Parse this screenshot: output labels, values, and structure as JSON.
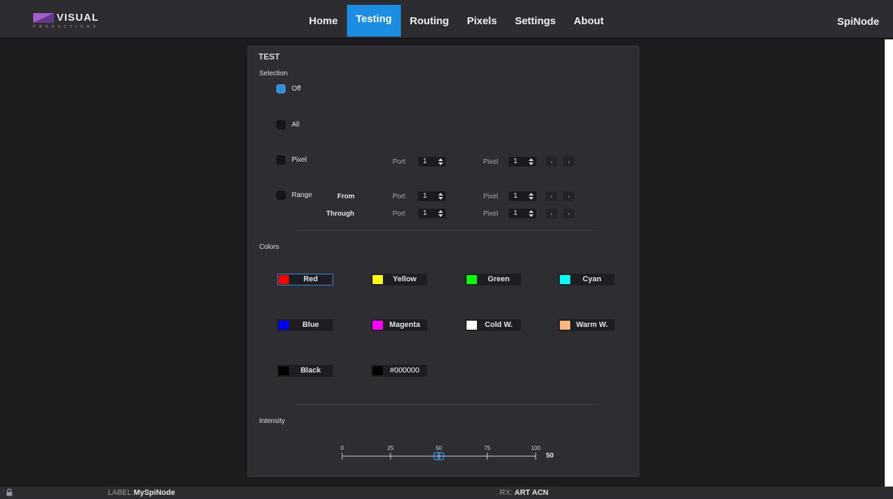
{
  "brand": {
    "name": "VISUAL",
    "tagline": "PRODUCTIONS",
    "colors": {
      "mark_light": "#a35fc9",
      "mark_dark": "#6a3592"
    }
  },
  "nav": {
    "items": [
      {
        "label": "Home"
      },
      {
        "label": "Testing"
      },
      {
        "label": "Routing"
      },
      {
        "label": "Pixels"
      },
      {
        "label": "Settings"
      },
      {
        "label": "About"
      }
    ],
    "active": "Testing"
  },
  "device_name": "SpiNode",
  "test": {
    "title": "TEST",
    "selection": {
      "label": "Selection",
      "options": [
        {
          "label": "Off",
          "checked": true
        },
        {
          "label": "All",
          "checked": false
        },
        {
          "label": "Pixel",
          "checked": false
        },
        {
          "label": "Range",
          "checked": false
        }
      ],
      "pixel_row": {
        "port_label": "Port",
        "port_value": "1",
        "pixel_label": "Pixel",
        "pixel_value": "1"
      },
      "range_from": {
        "label": "From",
        "port_label": "Port",
        "port_value": "1",
        "pixel_label": "Pixel",
        "pixel_value": "1"
      },
      "range_through": {
        "label": "Through",
        "port_label": "Port",
        "port_value": "1",
        "pixel_label": "Pixel",
        "pixel_value": "1"
      },
      "prev_glyph": "‹",
      "next_glyph": "›"
    },
    "colors": {
      "label": "Colors",
      "buttons": [
        {
          "label": "Red",
          "swatch": "#ff0000",
          "selected": true
        },
        {
          "label": "Yellow",
          "swatch": "#ffff00",
          "selected": false
        },
        {
          "label": "Green",
          "swatch": "#00ff00",
          "selected": false
        },
        {
          "label": "Cyan",
          "swatch": "#00ffff",
          "selected": false
        },
        {
          "label": "Blue",
          "swatch": "#0000ff",
          "selected": false
        },
        {
          "label": "Magenta",
          "swatch": "#ff00ff",
          "selected": false
        },
        {
          "label": "Cold W.",
          "swatch": "#ffffff",
          "selected": false
        },
        {
          "label": "Warm W.",
          "swatch": "#ffb77a",
          "selected": false
        },
        {
          "label": "Black",
          "swatch": "#000000",
          "selected": false
        }
      ],
      "custom_hex": "#000000"
    },
    "intensity": {
      "label": "Intensity",
      "min": 0,
      "max": 100,
      "ticks": [
        "0",
        "25",
        "50",
        "75",
        "100"
      ],
      "value": 50,
      "value_label": "50",
      "accent": "#2a8fe0"
    }
  },
  "footer": {
    "label_prefix": "LABEL:",
    "label_value": "MySpiNode",
    "rx_prefix": "RX:",
    "rx_value": "ART ACN",
    "lock_icon": "lock-icon"
  }
}
